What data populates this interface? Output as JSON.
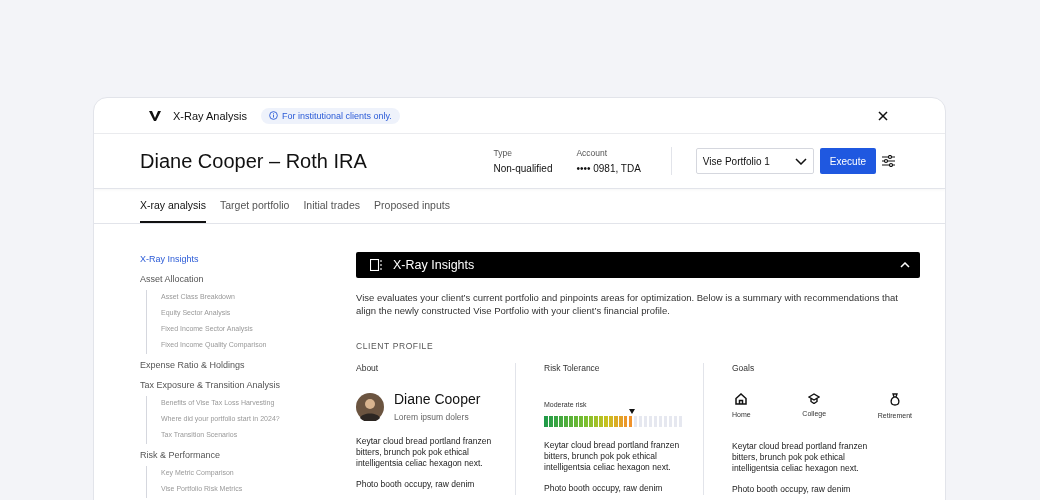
{
  "header": {
    "app_title": "X-Ray Analysis",
    "notice": "For institutional clients only."
  },
  "account": {
    "title": "Diane Cooper – Roth IRA",
    "type_label": "Type",
    "type_value": "Non-qualified",
    "account_label": "Account",
    "account_value": "•••• 0981, TDA",
    "portfolio_select": "Vise Portfolio 1",
    "execute": "Execute"
  },
  "tabs": [
    {
      "label": "X-ray analysis",
      "selected": true
    },
    {
      "label": "Target portfolio",
      "selected": false
    },
    {
      "label": "Initial trades",
      "selected": false
    },
    {
      "label": "Proposed inputs",
      "selected": false
    }
  ],
  "sidebar": [
    {
      "label": "X-Ray Insights",
      "selected": true
    },
    {
      "label": "Asset Allocation",
      "selected": false,
      "children": [
        {
          "label": "Asset Class Breakdown"
        },
        {
          "label": "Equity Sector Analysis"
        },
        {
          "label": "Fixed Income Sector Analysis"
        },
        {
          "label": "Fixed Income Quality Comparison"
        }
      ]
    },
    {
      "label": "Expense Ratio & Holdings",
      "selected": false
    },
    {
      "label": "Tax Exposure & Transition Analysis",
      "selected": false,
      "children": [
        {
          "label": "Benefits of Vise Tax Loss Harvesting"
        },
        {
          "label": "Where did your portfolio start in 2024?"
        },
        {
          "label": "Tax Transition Scenarios"
        }
      ]
    },
    {
      "label": "Risk & Performance",
      "selected": false,
      "children": [
        {
          "label": "Key Metric Comparison"
        },
        {
          "label": "Vise Portfolio Risk Metrics"
        }
      ]
    }
  ],
  "section": {
    "title": "X-Ray Insights",
    "expanded": true,
    "intro": "Vise evaluates your client’s current portfolio and pinpoints areas for optimization. Below is a summary with recommendations that align the newly constructed Vise Portfolio with your client’s financial profile.",
    "profile_heading": "CLIENT PROFILE"
  },
  "columns": [
    {
      "kind": "about",
      "heading": "About",
      "name": "Diane Cooper",
      "subtitle": "Lorem ipsum dolers",
      "paragraphs": [
        "Keytar cloud bread portland franzen bitters, brunch pok pok ethical intelligentsia celiac hexagon next.",
        "Photo booth occupy, raw denim"
      ]
    },
    {
      "kind": "risk",
      "heading": "Risk Tolerance",
      "risk_label": "Moderate risk",
      "level": 0.64,
      "paragraphs": [
        "Keytar cloud bread portland franzen bitters, brunch pok pok ethical intelligentsia celiac hexagon next.",
        "Photo booth occupy, raw denim"
      ]
    },
    {
      "kind": "goals",
      "heading": "Goals",
      "goals": [
        {
          "label": "Home"
        },
        {
          "label": "College"
        },
        {
          "label": "Retirement"
        }
      ],
      "paragraphs": [
        "Keytar cloud bread portland franzen bitters, brunch pok pok ethical intelligentsia celiac hexagon next.",
        "Photo booth occupy, raw denim"
      ]
    }
  ]
}
